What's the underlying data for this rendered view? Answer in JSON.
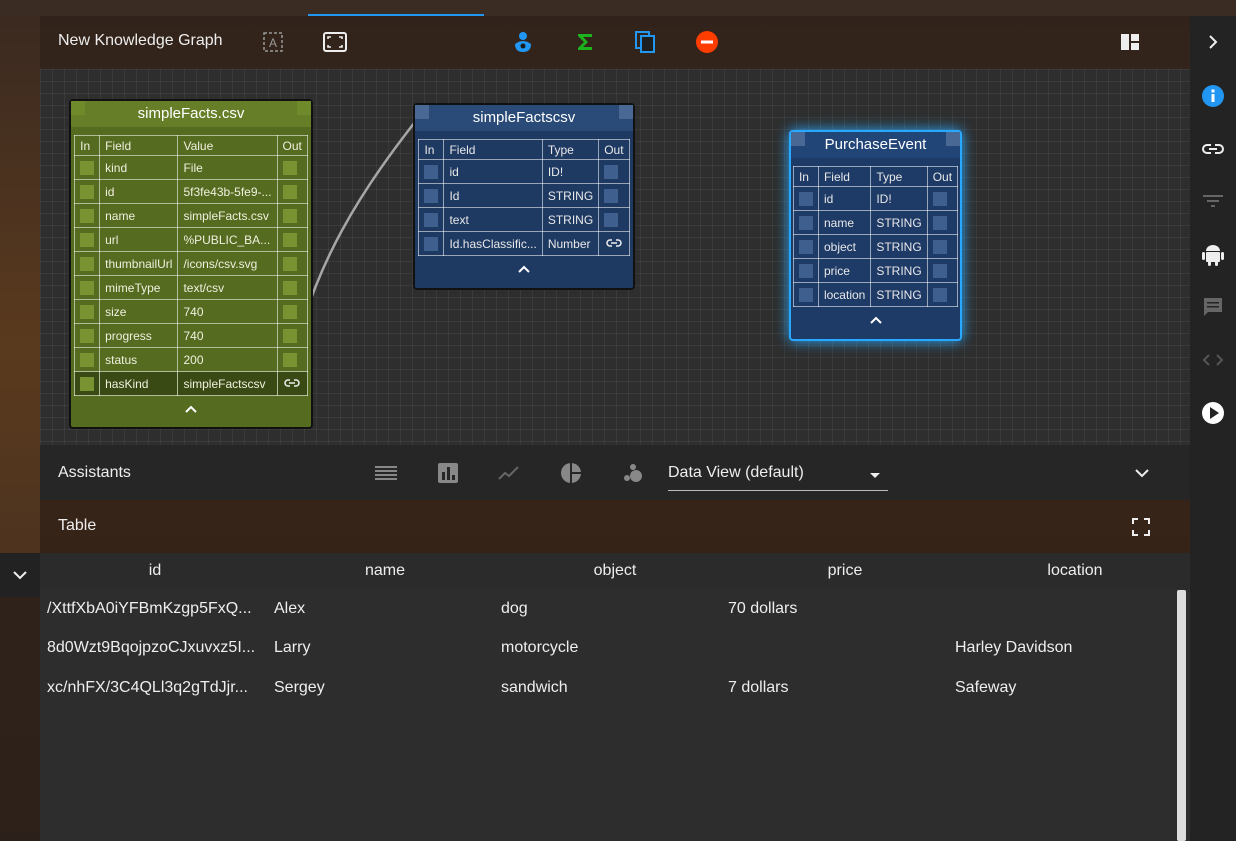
{
  "toolbar": {
    "title": "New Knowledge Graph",
    "icons": [
      "text-select-icon",
      "fit-screen-icon",
      "spa-icon",
      "sigma-icon",
      "copy-icon",
      "remove-icon",
      "dashboard-icon"
    ],
    "colors": {
      "spa": "#2196f3",
      "sigma": "#1db31d",
      "copy": "#2196f3",
      "remove": "#ff3d00"
    }
  },
  "nodes": {
    "simple_facts_csv": {
      "title": "simpleFacts.csv",
      "headers": [
        "In",
        "Field",
        "Value",
        "Out"
      ],
      "rows": [
        {
          "field": "kind",
          "value": "File"
        },
        {
          "field": "id",
          "value": "5f3fe43b-5fe9-..."
        },
        {
          "field": "name",
          "value": "simpleFacts.csv"
        },
        {
          "field": "url",
          "value": "%PUBLIC_BA..."
        },
        {
          "field": "thumbnailUrl",
          "value": "/icons/csv.svg"
        },
        {
          "field": "mimeType",
          "value": "text/csv"
        },
        {
          "field": "size",
          "value": "740"
        },
        {
          "field": "progress",
          "value": "740"
        },
        {
          "field": "status",
          "value": "200"
        },
        {
          "field": "hasKind",
          "value": "simpleFactscsv"
        }
      ]
    },
    "simple_factscsv": {
      "title": "simpleFactscsv",
      "headers": [
        "In",
        "Field",
        "Type",
        "Out"
      ],
      "rows": [
        {
          "field": "id",
          "type": "ID!"
        },
        {
          "field": "Id",
          "type": "STRING"
        },
        {
          "field": "text",
          "type": "STRING"
        },
        {
          "field": "Id.hasClassific...",
          "type": "Number"
        }
      ]
    },
    "purchase_event": {
      "title": "PurchaseEvent",
      "headers": [
        "In",
        "Field",
        "Type",
        "Out"
      ],
      "rows": [
        {
          "field": "id",
          "type": "ID!"
        },
        {
          "field": "name",
          "type": "STRING"
        },
        {
          "field": "object",
          "type": "STRING"
        },
        {
          "field": "price",
          "type": "STRING"
        },
        {
          "field": "location",
          "type": "STRING"
        }
      ]
    }
  },
  "assistants": {
    "label": "Assistants",
    "view_select": "Data View (default)"
  },
  "table_panel": {
    "label": "Table",
    "columns": [
      "id",
      "name",
      "object",
      "price",
      "location"
    ],
    "rows": [
      [
        "/XttfXbA0iYFBmKzgp5FxQ...",
        "Alex",
        "dog",
        "70 dollars",
        ""
      ],
      [
        "8d0Wzt9BqojpzoCJxuvxz5I...",
        "Larry",
        "motorcycle",
        "",
        "Harley Davidson"
      ],
      [
        "xc/nhFX/3C4QLl3q2gTdJjr...",
        "Sergey",
        "sandwich",
        "7 dollars",
        "Safeway"
      ]
    ]
  },
  "sidebar": {
    "icons": [
      "chevron-right-icon",
      "info-icon",
      "link-icon",
      "filter-icon",
      "android-icon",
      "comment-icon",
      "code-icon",
      "play-icon"
    ],
    "accent": "#2196f3"
  }
}
